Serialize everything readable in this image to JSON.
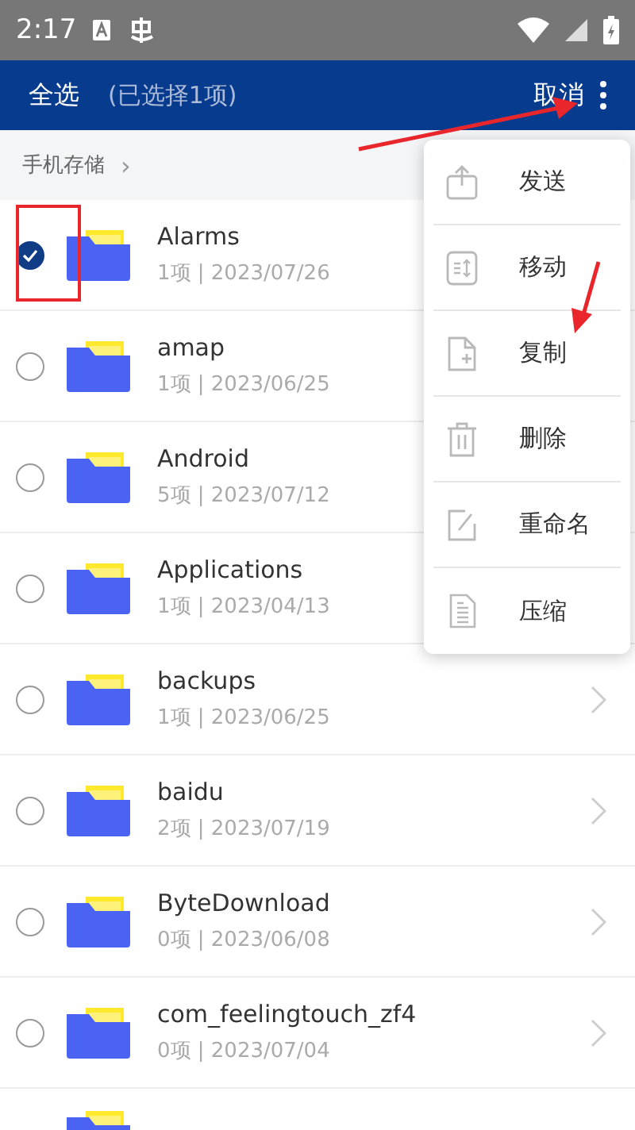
{
  "status_bar": {
    "time": "2:17"
  },
  "app_bar": {
    "select_all": "全选",
    "selection_count": "(已选择1项)",
    "cancel": "取消"
  },
  "breadcrumb": {
    "path": "手机存储",
    "separator": "›"
  },
  "files": [
    {
      "name": "Alarms",
      "meta": "1项 | 2023/07/26",
      "selected": true,
      "chevron": false
    },
    {
      "name": "amap",
      "meta": "1项 | 2023/06/25",
      "selected": false,
      "chevron": false
    },
    {
      "name": "Android",
      "meta": "5项 | 2023/07/12",
      "selected": false,
      "chevron": false
    },
    {
      "name": "Applications",
      "meta": "1项 | 2023/04/13",
      "selected": false,
      "chevron": false
    },
    {
      "name": "backups",
      "meta": "1项 | 2023/06/25",
      "selected": false,
      "chevron": true
    },
    {
      "name": "baidu",
      "meta": "2项 | 2023/07/19",
      "selected": false,
      "chevron": true
    },
    {
      "name": "ByteDownload",
      "meta": "0项 | 2023/06/08",
      "selected": false,
      "chevron": true
    },
    {
      "name": "com_feelingtouch_zf4",
      "meta": "0项 | 2023/07/04",
      "selected": false,
      "chevron": true
    }
  ],
  "menu": [
    {
      "kind": "send",
      "label": "发送"
    },
    {
      "kind": "move",
      "label": "移动"
    },
    {
      "kind": "copy",
      "label": "复制"
    },
    {
      "kind": "delete",
      "label": "删除"
    },
    {
      "kind": "rename",
      "label": "重命名"
    },
    {
      "kind": "compress",
      "label": "压缩"
    }
  ]
}
